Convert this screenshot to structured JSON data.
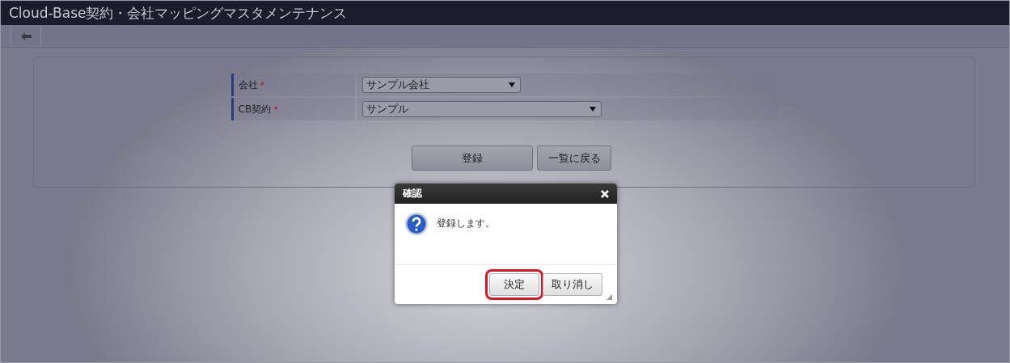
{
  "window": {
    "title": "Cloud-Base契約・会社マッピングマスタメンテナンス"
  },
  "form": {
    "fields": [
      {
        "label": "会社",
        "required_mark": "*",
        "value": "サンプル会社",
        "kind": "short"
      },
      {
        "label": "CB契約",
        "required_mark": "*",
        "value": "サンプル",
        "kind": "long"
      }
    ],
    "buttons": [
      {
        "label": "登録",
        "kind": "wide"
      },
      {
        "label": "一覧に戻る",
        "kind": "narrow"
      }
    ]
  },
  "dialog": {
    "title": "確認",
    "message": "登録します。",
    "buttons": [
      {
        "label": "決定",
        "highlighted": true
      },
      {
        "label": "取り消し",
        "highlighted": false
      }
    ]
  }
}
